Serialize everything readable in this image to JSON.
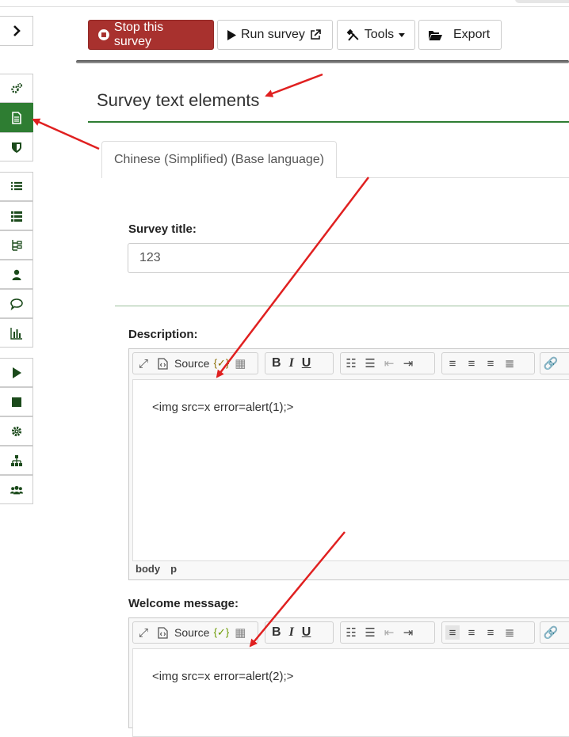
{
  "sidebar": {
    "toggle_icon": "chevron-right-icon",
    "items": [
      {
        "icon": "gears-icon",
        "active": false
      },
      {
        "icon": "document-icon",
        "active": true
      },
      {
        "icon": "shield-icon",
        "active": false
      },
      {
        "icon": "list-icon",
        "active": false
      },
      {
        "icon": "list-alt-icon",
        "active": false
      },
      {
        "icon": "sitemap-branch-icon",
        "active": false
      },
      {
        "icon": "user-icon",
        "active": false
      },
      {
        "icon": "comment-icon",
        "active": false
      },
      {
        "icon": "bar-chart-icon",
        "active": false
      },
      {
        "icon": "play-icon",
        "active": false
      },
      {
        "icon": "stop-icon",
        "active": false
      },
      {
        "icon": "gear-icon",
        "active": false
      },
      {
        "icon": "hierarchy-icon",
        "active": false
      },
      {
        "icon": "users-icon",
        "active": false
      }
    ]
  },
  "toolbar": {
    "stop_label": "Stop this survey",
    "run_label": "Run survey",
    "tools_label": "Tools",
    "export_label": "Export"
  },
  "page": {
    "title": "Survey text elements",
    "tab_label": "Chinese (Simplified) (Base language)"
  },
  "form": {
    "survey_title_label": "Survey title:",
    "survey_title_value": "123",
    "description_label": "Description:",
    "description_content": "<img src=x error=alert(1);>",
    "description_path": [
      "body",
      "p"
    ],
    "welcome_label": "Welcome message:",
    "welcome_content": "<img src=x error=alert(2);>",
    "editor_source_label": "Source",
    "editor_bold": "B",
    "editor_italic": "I",
    "editor_underline": "U"
  },
  "colors": {
    "accent_green": "#2e7d32",
    "danger": "#a8312e",
    "annotation_arrow": "#e02020"
  }
}
